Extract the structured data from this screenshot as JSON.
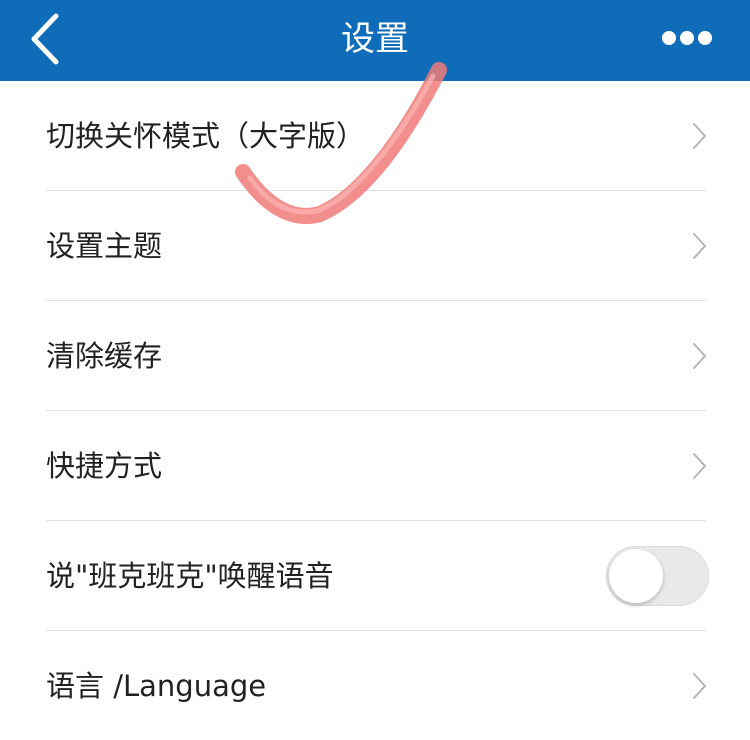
{
  "header": {
    "title": "设置",
    "background_color": "#0f6cb8",
    "back_icon": "chevron-left-icon",
    "more_icon": "ellipsis-icon"
  },
  "settings": {
    "items": [
      {
        "label": "切换关怀模式（大字版）",
        "control": "chevron"
      },
      {
        "label": "设置主题",
        "control": "chevron"
      },
      {
        "label": "清除缓存",
        "control": "chevron"
      },
      {
        "label": "快捷方式",
        "control": "chevron"
      },
      {
        "label": "说\"班克班克\"唤醒语音",
        "control": "toggle",
        "toggle_on": false
      },
      {
        "label": "语言 /Language",
        "control": "chevron"
      }
    ]
  }
}
